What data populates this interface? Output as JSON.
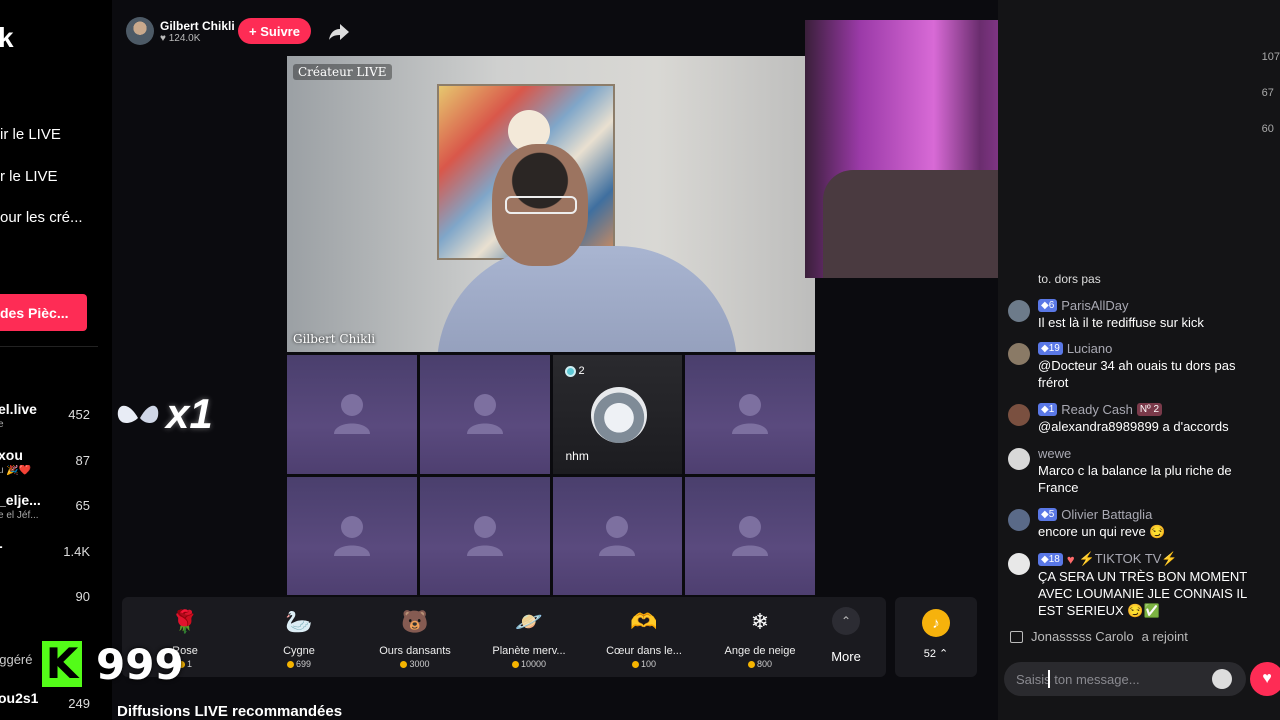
{
  "sidebar": {
    "logo_fragment": "k",
    "links": [
      "ir le LIVE",
      "r le LIVE",
      "our les cré..."
    ],
    "coins_button": "des Pièc...",
    "rankings": [
      {
        "name": "el.live",
        "sub": "e",
        "count": "452"
      },
      {
        "name": "xou",
        "sub": "u 🎉❤️",
        "count": "87"
      },
      {
        "name": "_elje...",
        "sub": "e el Jéf...",
        "count": "65"
      },
      {
        "name": "-",
        "sub": "",
        "count": "1.4K"
      },
      {
        "name": "",
        "sub": "",
        "count": "90"
      }
    ],
    "suggested_label": "uggéré",
    "bottom_user": {
      "name": "ou2s1",
      "count": "249"
    }
  },
  "host": {
    "name": "Gilbert Chikli",
    "likes": "124.0K",
    "follow_label": "+ Suivre"
  },
  "main_video": {
    "top_label": "Créateur LIVE",
    "bottom_label": "Gilbert Chikli"
  },
  "guest": {
    "badge_count": "2",
    "name": "nhm"
  },
  "gift_overlay": {
    "multiplier": "x1"
  },
  "gifts": [
    {
      "name": "Rose",
      "price": "1",
      "icon": "🌹"
    },
    {
      "name": "Cygne",
      "price": "699",
      "icon": "🦢"
    },
    {
      "name": "Ours dansants",
      "price": "3000",
      "icon": "🐻"
    },
    {
      "name": "Planète merv...",
      "price": "10000",
      "icon": "🪐"
    },
    {
      "name": "Cœur dans le...",
      "price": "100",
      "icon": "🫶"
    },
    {
      "name": "Ange de neige",
      "price": "800",
      "icon": "❄"
    }
  ],
  "more_label": "More",
  "coin_balance": "52",
  "recommended_title": "Diffusions LIVE recommandées",
  "kick": {
    "count": "999"
  },
  "chat": {
    "scroll_numbers": [
      "107",
      "67",
      "60"
    ],
    "partial_text": "to. dors pas",
    "messages": [
      {
        "level": "6",
        "user": "ParisAllDay",
        "text": "Il est là il te rediffuse sur kick",
        "avatar_color": "#6d7b8a"
      },
      {
        "level": "19",
        "user": "Luciano",
        "text": "@Docteur 34 ah ouais tu dors pas frérot",
        "avatar_color": "#8a7a66"
      },
      {
        "level": "1",
        "user": "Ready Cash",
        "badge": "Nº 2",
        "text": "@alexandra8989899 a d'accords",
        "avatar_color": "#7a5040"
      },
      {
        "user": "wewe",
        "text": "Marco c la balance la plu riche de France",
        "avatar_color": "#d8d8d8"
      },
      {
        "level": "5",
        "user": "Olivier Battaglia",
        "text": "encore un qui reve 😏",
        "avatar_color": "#5a6a88"
      },
      {
        "level": "18",
        "user": "⚡TIKTOK TV⚡",
        "text": "ÇA SERA UN TRÈS BON MOMENT AVEC LOUMANIE JLE CONNAIS IL EST SERIEUX 😏✅",
        "avatar_color": "#e8e8e8"
      }
    ],
    "join_user": "Jonasssss Carolo",
    "join_text": "a rejoint",
    "input_placeholder": "Saisis ton message..."
  }
}
